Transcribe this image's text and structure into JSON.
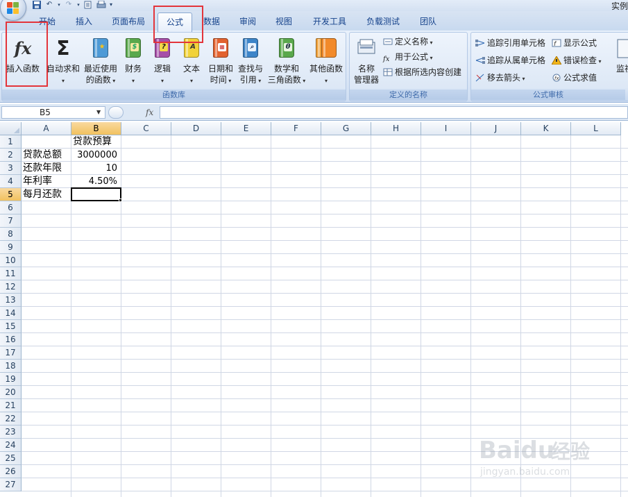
{
  "title_bar": {
    "title": "实例"
  },
  "tabs": [
    {
      "label": "开始",
      "active": false
    },
    {
      "label": "插入",
      "active": false
    },
    {
      "label": "页面布局",
      "active": false
    },
    {
      "label": "公式",
      "active": true
    },
    {
      "label": "数据",
      "active": false
    },
    {
      "label": "审阅",
      "active": false
    },
    {
      "label": "视图",
      "active": false
    },
    {
      "label": "开发工具",
      "active": false
    },
    {
      "label": "负载测试",
      "active": false
    },
    {
      "label": "团队",
      "active": false
    }
  ],
  "ribbon": {
    "function_library": {
      "label": "函数库",
      "insert_function": "插入函数",
      "autosum": "自动求和",
      "recent_line1": "最近使用",
      "recent_line2": "的函数",
      "financial": "财务",
      "logical": "逻辑",
      "text": "文本",
      "datetime_line1": "日期和",
      "datetime_line2": "时间",
      "lookup_line1": "查找与",
      "lookup_line2": "引用",
      "math_line1": "数学和",
      "math_line2": "三角函数",
      "more": "其他函数"
    },
    "defined_names": {
      "label": "定义的名称",
      "name_manager_line1": "名称",
      "name_manager_line2": "管理器",
      "define_name": "定义名称",
      "use_in_formula": "用于公式",
      "create_from_selection": "根据所选内容创建"
    },
    "formula_auditing": {
      "label": "公式审核",
      "trace_precedents": "追踪引用单元格",
      "trace_dependents": "追踪从属单元格",
      "remove_arrows": "移去箭头",
      "show_formulas": "显示公式",
      "error_checking": "错误检查",
      "evaluate_formula": "公式求值",
      "watch_window": "监视"
    }
  },
  "formula_bar": {
    "name_box": "B5",
    "fx_label": "fx",
    "formula": ""
  },
  "sheet": {
    "columns": [
      "A",
      "B",
      "C",
      "D",
      "E",
      "F",
      "G",
      "H",
      "I",
      "J",
      "K",
      "L"
    ],
    "selected_column": "B",
    "selected_row": 5,
    "rows": [
      "1",
      "2",
      "3",
      "4",
      "5",
      "6",
      "7",
      "8",
      "9",
      "10",
      "11",
      "12",
      "13",
      "14",
      "15",
      "16",
      "17",
      "18",
      "19",
      "20",
      "21",
      "22",
      "23",
      "24",
      "25",
      "26",
      "27"
    ],
    "cells": {
      "B1": "贷款预算",
      "A2": "贷款总额",
      "B2": "3000000",
      "A3": "还款年限",
      "B3": "10",
      "A4": "年利率",
      "B4": "4.50%",
      "A5": "每月还款"
    }
  },
  "watermark": {
    "brand": "Baidu",
    "brand_cn": "经验",
    "url": "jingyan.baidu.com"
  },
  "colors": {
    "annotation": "#e3343a",
    "tab_text": "#15428b",
    "selection": "#f1c15f"
  }
}
